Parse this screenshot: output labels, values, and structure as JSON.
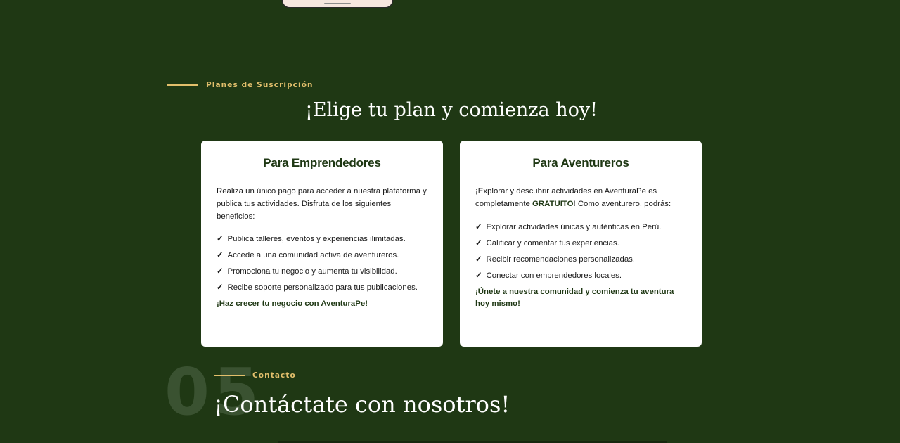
{
  "plans_section": {
    "eyebrow": "Planes de Suscripción",
    "title": "¡Elige tu plan y comienza hoy!",
    "cards": [
      {
        "title": "Para Emprendedores",
        "intro": "Realiza un único pago para acceder a nuestra plataforma y publica tus actividades. Disfruta de los siguientes beneficios:",
        "benefits": [
          "Publica talleres, eventos y experiencias ilimitadas.",
          "Accede a una comunidad activa de aventureros.",
          "Promociona tu negocio y aumenta tu visibilidad.",
          "Recibe soporte personalizado para tus publicaciones."
        ],
        "cta": "¡Haz crecer tu negocio con AventuraPe!"
      },
      {
        "title": "Para Aventureros",
        "intro_before": "¡Explorar y descubrir actividades en AventuraPe es completamente ",
        "intro_highlight": "GRATUITO",
        "intro_after": "! Como aventurero, podrás:",
        "benefits": [
          "Explorar actividades únicas y auténticas en Perú.",
          "Calificar y comentar tus experiencias.",
          "Recibir recomendaciones personalizadas.",
          "Conectar con emprendedores locales."
        ],
        "cta": "¡Únete a nuestra comunidad y comienza tu aventura hoy mismo!"
      }
    ],
    "check_mark": "✓"
  },
  "contact_section": {
    "number": "05",
    "eyebrow": "Contacto",
    "title": "¡Contáctate con nosotros!"
  },
  "colors": {
    "background": "#1f3814",
    "accent": "#e2bf6c",
    "card": "#ffffff",
    "brand_green": "#1f3814"
  }
}
